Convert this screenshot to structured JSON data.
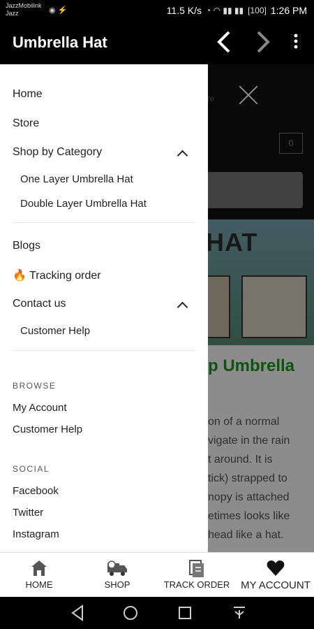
{
  "status_bar": {
    "carrier_line1": "JazzMobilink",
    "carrier_line2": "Jazz",
    "speed": "11.5 K/s",
    "battery": "100",
    "time": "1:26 PM"
  },
  "app_bar": {
    "title": "Umbrella Hat"
  },
  "background_page": {
    "more_text": "ore",
    "cart_count": "0",
    "banner_text": "HAT",
    "heading_fragment": "p Umbrella",
    "paragraph_lines": [
      "on of a normal",
      "vigate in the rain",
      "t around. It is",
      "tick) strapped to",
      "nopy is attached",
      "etimes looks like",
      "head like a hat."
    ]
  },
  "drawer": {
    "main_menu": [
      {
        "label": "Home"
      },
      {
        "label": "Store"
      },
      {
        "label": "Shop by Category",
        "expanded": true
      }
    ],
    "category_submenu": [
      {
        "label": "One Layer Umbrella Hat"
      },
      {
        "label": "Double Layer Umbrella Hat"
      }
    ],
    "secondary_menu": [
      {
        "label": "Blogs"
      },
      {
        "label": "Tracking order",
        "icon": "fire-icon"
      },
      {
        "label": "Contact us",
        "expanded": true
      }
    ],
    "contact_submenu": [
      {
        "label": "Customer Help"
      }
    ],
    "browse": {
      "title": "BROWSE",
      "items": [
        {
          "label": "My Account"
        },
        {
          "label": "Customer Help"
        }
      ]
    },
    "social": {
      "title": "SOCIAL",
      "items": [
        {
          "label": "Facebook"
        },
        {
          "label": "Twitter"
        },
        {
          "label": "Instagram"
        }
      ]
    }
  },
  "bottom_nav": {
    "items": [
      {
        "label": "HOME",
        "icon": "home-icon"
      },
      {
        "label": "SHOP",
        "icon": "truck-icon"
      },
      {
        "label": "TRACK ORDER",
        "icon": "track-order-icon"
      },
      {
        "label": "MY ACCOUNT",
        "icon": "heart-icon"
      }
    ]
  },
  "colors": {
    "appbar_bg": "#000000",
    "heading_green": "#1a9a1a"
  }
}
